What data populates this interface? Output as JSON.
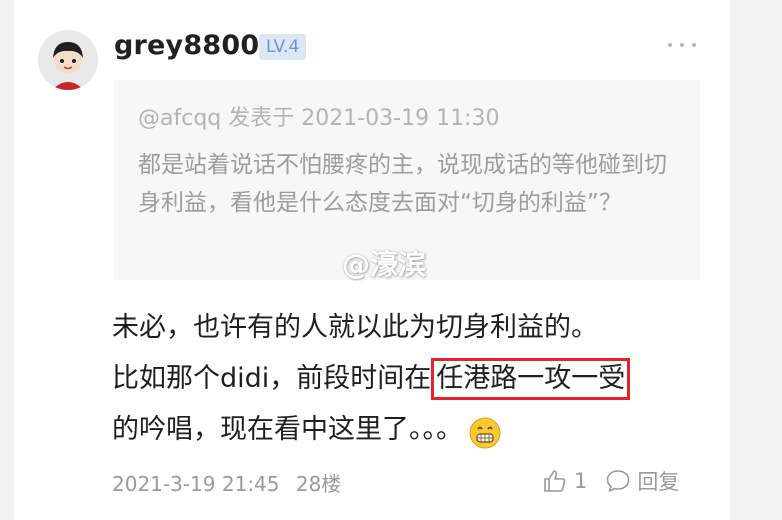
{
  "post": {
    "username": "grey8800",
    "level": "LV.4",
    "quote": {
      "meta": "@afcqq 发表于 2021-03-19 11:30",
      "text": "都是站着说话不怕腰疼的主，说现成话的等他碰到切身利益，看他是什么态度去面对“切身的利益”？"
    },
    "watermark": "@濠滨",
    "body": {
      "line1": "未必，也许有的人就以此为切身利益的。",
      "line2_prefix": "比如那个didi，前段时间在",
      "highlight": "任港路一攻一受",
      "line3": "的吟唱，现在看中这里了。。。"
    },
    "emoji_icon": "grinning-emoji-icon",
    "meta": {
      "datetime": "2021-3-19 21:45",
      "floor": "28楼"
    },
    "actions": {
      "like_count": "1",
      "reply_label": "回复"
    }
  },
  "colors": {
    "highlight_border": "#e5222c",
    "level_bg": "#dbe6f7",
    "level_text": "#7393cf"
  }
}
